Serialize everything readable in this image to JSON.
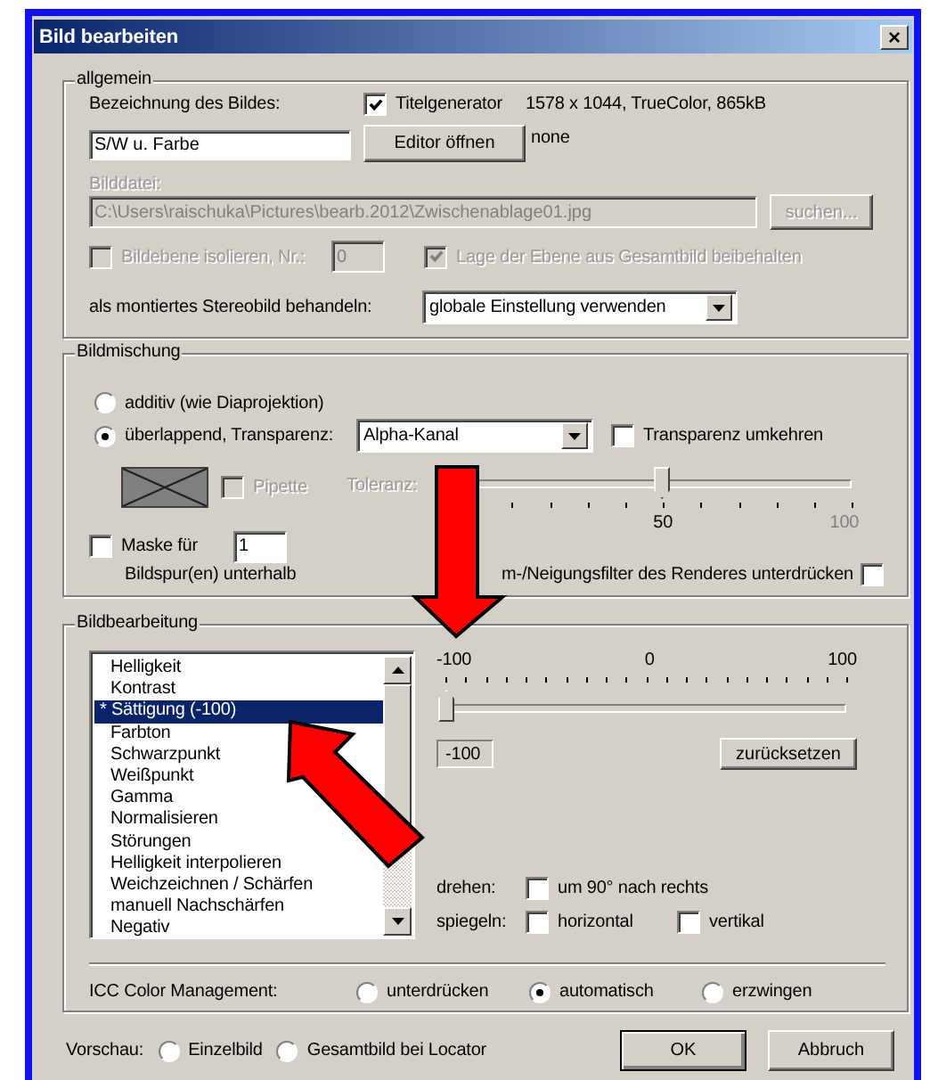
{
  "window": {
    "title": "Bild bearbeiten",
    "close": "×"
  },
  "general": {
    "legend": "allgemein",
    "name_label": "Bezeichnung des Bildes:",
    "name_value": "S/W u. Farbe",
    "title_generator": {
      "label": "Titelgenerator",
      "checked": true
    },
    "info": "1578 x 1044, TrueColor, 865kB",
    "info2": "none",
    "editor_button": "Editor öffnen",
    "file_label": "Bilddatei:",
    "file_value": "C:\\Users\\raischuka\\Pictures\\bearb.2012\\Zwischenablage01.jpg",
    "file_disabled": true,
    "browse_button": "suchen...",
    "isolate": {
      "label": "Bildebene isolieren, Nr.:",
      "checked": false,
      "disabled": true
    },
    "layer_number": "0",
    "keep_position": {
      "label": "Lage der Ebene aus Gesamtbild beibehalten",
      "checked": true,
      "disabled": true
    },
    "stereo_label": "als montiertes Stereobild behandeln:",
    "stereo_value": "globale Einstellung verwenden"
  },
  "blending": {
    "legend": "Bildmischung",
    "modes": [
      {
        "label": "additiv (wie Diaprojektion)",
        "selected": false
      },
      {
        "label": "überlappend, Transparenz:",
        "selected": true
      }
    ],
    "transparency_value": "Alpha-Kanal",
    "invert": {
      "label": "Transparenz umkehren",
      "checked": false
    },
    "pipette": {
      "label": "Pipette",
      "checked": false,
      "disabled": true
    },
    "tolerance": {
      "label": "Toleranz:",
      "disabled": true,
      "level": 0.5,
      "tick_labels": [
        "50",
        "100"
      ]
    },
    "mask": {
      "label": "Maske für",
      "checked": false
    },
    "mask_value": "1",
    "mask_caption": "Bildspur(en) unterhalb",
    "filter": {
      "label": "m-/Neigungsfilter des Renderes unterdrücken",
      "checked": false
    }
  },
  "editing": {
    "legend": "Bildbearbeitung",
    "items": [
      {
        "label": "Helligkeit",
        "selected": false
      },
      {
        "label": "Kontrast",
        "selected": false
      },
      {
        "label": "* Sättigung (-100)",
        "selected": true
      },
      {
        "label": "Farbton",
        "selected": false
      },
      {
        "label": "Schwarzpunkt",
        "selected": false
      },
      {
        "label": "Weißpunkt",
        "selected": false
      },
      {
        "label": "Gamma",
        "selected": false
      },
      {
        "label": "Normalisieren",
        "selected": false
      },
      {
        "label": "Störungen",
        "selected": false
      },
      {
        "label": "Helligkeit interpolieren",
        "selected": false
      },
      {
        "label": "Weichzeichnen / Schärfen",
        "selected": false
      },
      {
        "label": "manuell Nachschärfen",
        "selected": false
      },
      {
        "label": "Negativ",
        "selected": false
      }
    ],
    "slider": {
      "tick_labels": [
        "-100",
        "0",
        "100"
      ],
      "level": 0
    },
    "value": "-100",
    "reset_button": "zurücksetzen",
    "rotate_label": "drehen:",
    "rotate": {
      "label": "um 90° nach rechts",
      "checked": false
    },
    "mirror_label": "spiegeln:",
    "mirror": [
      {
        "label": "horizontal",
        "checked": false
      },
      {
        "label": "vertikal",
        "checked": false
      }
    ],
    "icc_label": "ICC Color Management:",
    "icc_options": [
      {
        "label": "unterdrücken",
        "selected": false
      },
      {
        "label": "automatisch",
        "selected": true
      },
      {
        "label": "erzwingen",
        "selected": false
      }
    ]
  },
  "footer": {
    "preview_label": "Vorschau:",
    "preview_options": [
      {
        "label": "Einzelbild",
        "selected": false
      },
      {
        "label": "Gesamtbild bei Locator",
        "selected": false
      }
    ],
    "buttons": [
      "OK",
      "Abbruch"
    ]
  }
}
